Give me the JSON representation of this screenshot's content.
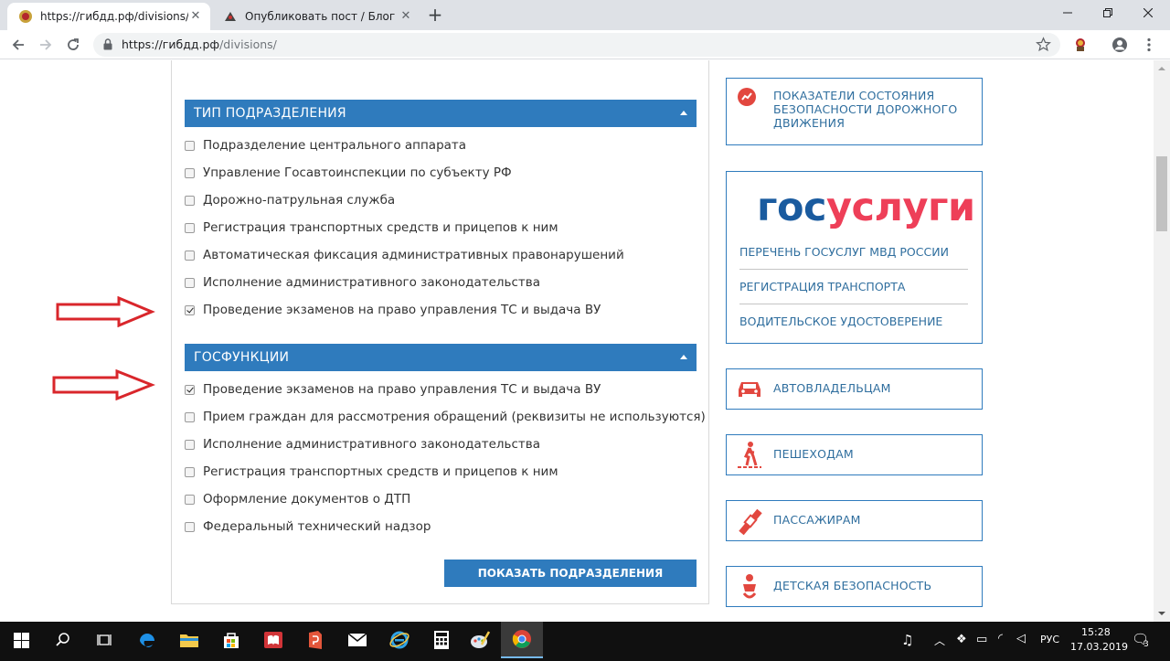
{
  "browser": {
    "tabs": [
      {
        "title": "https://гибдд.рф/divisions/",
        "active": true
      },
      {
        "title": "Опубликовать пост / Блог / Бай",
        "active": false
      }
    ],
    "url_host": "https://гибдд.рф",
    "url_path": "/divisions/"
  },
  "form": {
    "section1": {
      "title": "ТИП ПОДРАЗДЕЛЕНИЯ",
      "options": [
        {
          "label": "Подразделение центрального аппарата",
          "checked": false
        },
        {
          "label": "Управление Госавтоинспекции по субъекту РФ",
          "checked": false
        },
        {
          "label": "Дорожно-патрульная служба",
          "checked": false
        },
        {
          "label": "Регистрация транспортных средств и прицепов к ним",
          "checked": false
        },
        {
          "label": "Автоматическая фиксация административных правонарушений",
          "checked": false
        },
        {
          "label": "Исполнение административного законодательства",
          "checked": false
        },
        {
          "label": "Проведение экзаменов на право управления ТС и выдача ВУ",
          "checked": true
        }
      ]
    },
    "section2": {
      "title": "ГОСФУНКЦИИ",
      "options": [
        {
          "label": "Проведение экзаменов на право управления ТС и выдача ВУ",
          "checked": true
        },
        {
          "label": "Прием граждан для рассмотрения обращений (реквизиты не используются)",
          "checked": false
        },
        {
          "label": "Исполнение административного законодательства",
          "checked": false
        },
        {
          "label": "Регистрация транспортных средств и прицепов к ним",
          "checked": false
        },
        {
          "label": "Оформление документов о ДТП",
          "checked": false
        },
        {
          "label": "Федеральный технический надзор",
          "checked": false
        }
      ]
    },
    "submit_label": "ПОКАЗАТЬ ПОДРАЗДЕЛЕНИЯ"
  },
  "sidebar": {
    "safety_stats": "ПОКАЗАТЕЛИ СОСТОЯНИЯ БЕЗОПАСНОСТИ ДОРОЖНОГО ДВИЖЕНИЯ",
    "gosuslugi": {
      "logo_part1": "гос",
      "logo_part2": "услуги",
      "links": [
        "ПЕРЕЧЕНЬ ГОСУСЛУГ МВД РОССИИ",
        "РЕГИСТРАЦИЯ ТРАНСПОРТА",
        "ВОДИТЕЛЬСКОЕ УДОСТОВЕРЕНИЕ"
      ]
    },
    "items": [
      {
        "label": "АВТОВЛАДЕЛЬЦАМ",
        "icon": "car-icon"
      },
      {
        "label": "ПЕШЕХОДАМ",
        "icon": "pedestrian-icon"
      },
      {
        "label": "ПАССАЖИРАМ",
        "icon": "seatbelt-icon"
      },
      {
        "label": "ДЕТСКАЯ БЕЗОПАСНОСТЬ",
        "icon": "child-icon"
      }
    ]
  },
  "taskbar": {
    "lang": "РУС",
    "time": "15:28",
    "date": "17.03.2019",
    "notifications": "3"
  },
  "colors": {
    "accent": "#2f7bbd",
    "annotation_arrow": "#d9262b",
    "gosuslugi_blue": "#1a5b9f",
    "gosuslugi_red": "#ee3f58"
  }
}
